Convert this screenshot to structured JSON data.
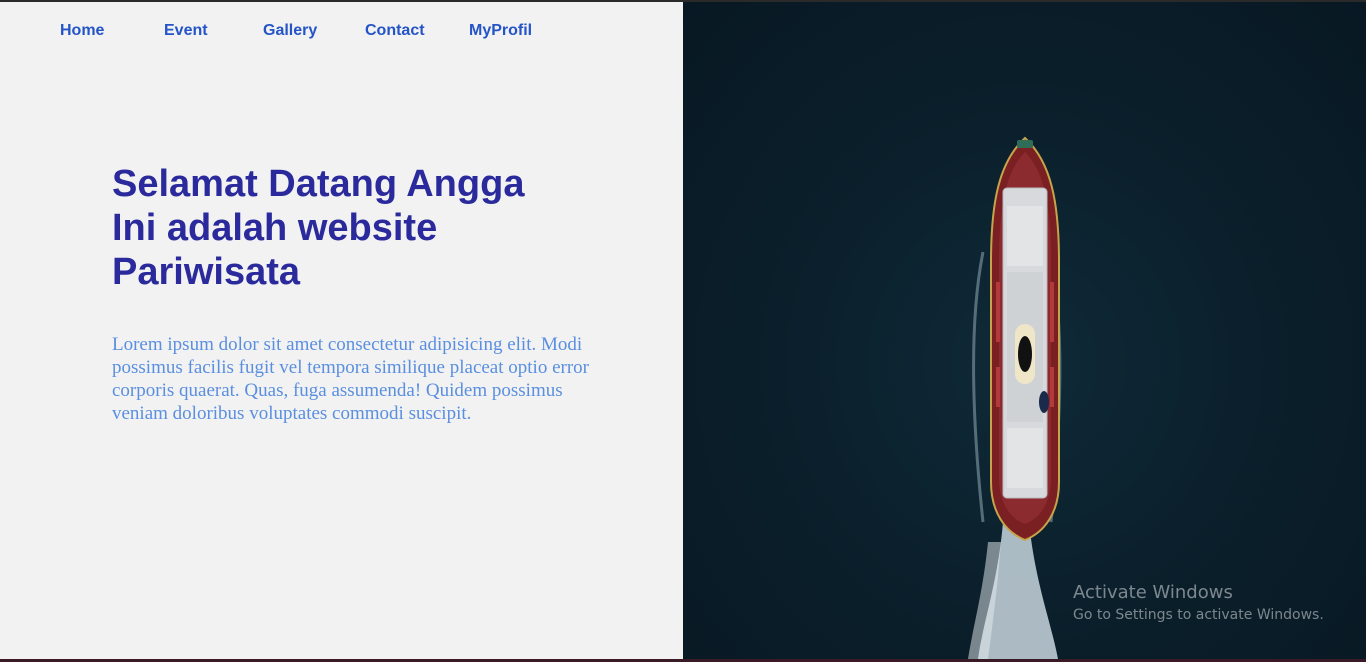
{
  "nav": {
    "items": [
      {
        "label": "Home"
      },
      {
        "label": "Event"
      },
      {
        "label": "Gallery"
      },
      {
        "label": "Contact"
      },
      {
        "label": "MyProfil"
      }
    ]
  },
  "hero": {
    "title_lines": [
      "Selamat Datang Angga",
      "Ini adalah website",
      "Pariwisata"
    ],
    "paragraph": "Lorem ipsum dolor sit amet consectetur adipisicing elit. Modi possimus facilis fugit vel tempora similique placeat optio error corporis quaerat. Quas, fuga assumenda! Quidem possimus veniam doloribus voluptates commodi suscipit."
  },
  "watermark": {
    "title": "Activate Windows",
    "subtitle": "Go to Settings to activate Windows."
  },
  "colors": {
    "nav_link": "#2454c8",
    "title": "#2a2a9c",
    "paragraph": "#5a8fe0",
    "left_bg": "#f2f2f2",
    "sea": "#0b202c"
  }
}
